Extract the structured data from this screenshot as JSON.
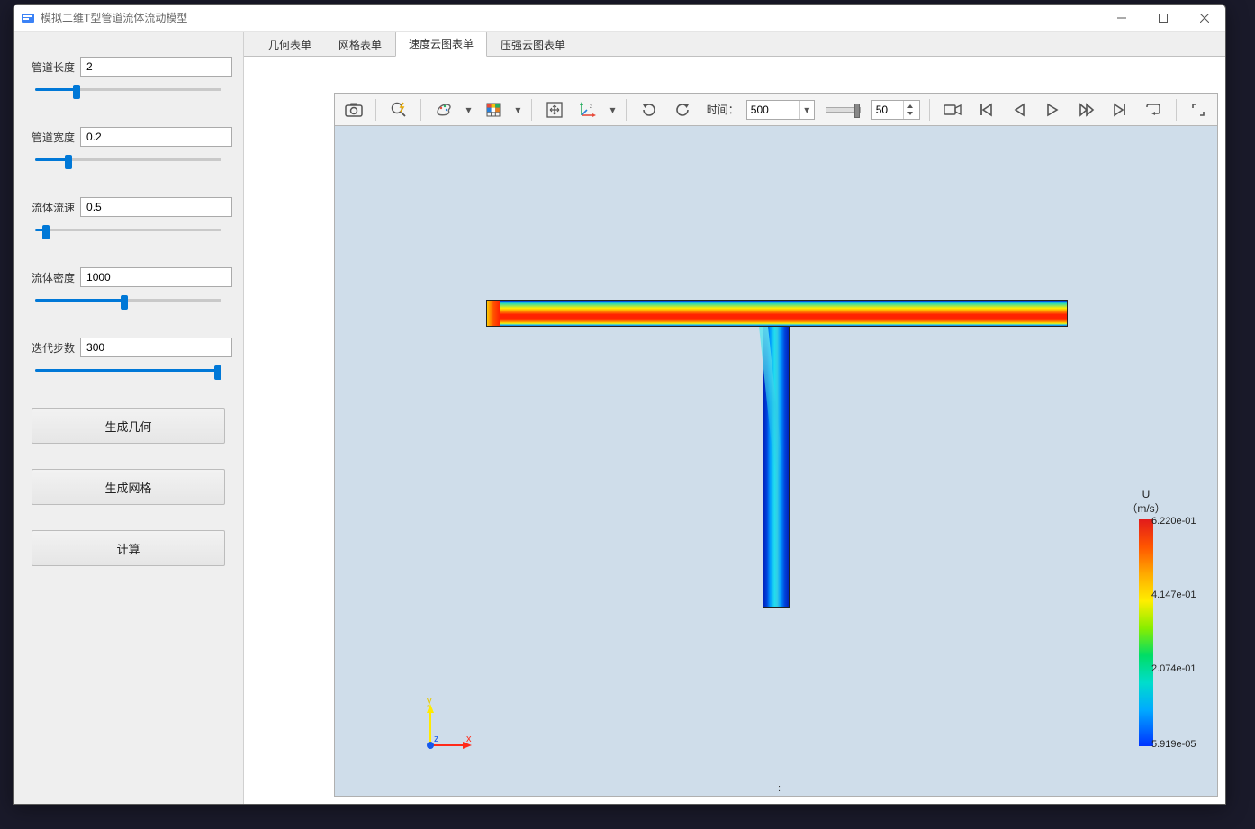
{
  "window": {
    "title": "模拟二维T型管道流体流动模型"
  },
  "sidebar": {
    "params": [
      {
        "label": "管道长度",
        "value": "2",
        "pct": 22
      },
      {
        "label": "管道宽度",
        "value": "0.2",
        "pct": 18
      },
      {
        "label": "流体流速",
        "value": "0.5",
        "pct": 6
      },
      {
        "label": "流体密度",
        "value": "1000",
        "pct": 48
      },
      {
        "label": "迭代步数",
        "value": "300",
        "pct": 98
      }
    ],
    "buttons": {
      "generate_geometry": "生成几何",
      "generate_mesh": "生成网格",
      "compute": "计算"
    }
  },
  "tabs": {
    "items": [
      "几何表单",
      "网格表单",
      "速度云图表单",
      "压强云图表单"
    ],
    "active_index": 2
  },
  "viewer_toolbar": {
    "time_label": "时间：",
    "time_value": "500",
    "stride_value": "50"
  },
  "axis": {
    "x": "x",
    "y": "y",
    "z": "z"
  },
  "colorscale": {
    "title_line1": "U",
    "title_line2": "（m/s）",
    "ticks": [
      "6.220e-01",
      "4.147e-01",
      "2.074e-01",
      "5.919e-05"
    ]
  },
  "status": ":",
  "colors": {
    "accent": "#0078d7",
    "canvas_bg": "#cfddea"
  }
}
